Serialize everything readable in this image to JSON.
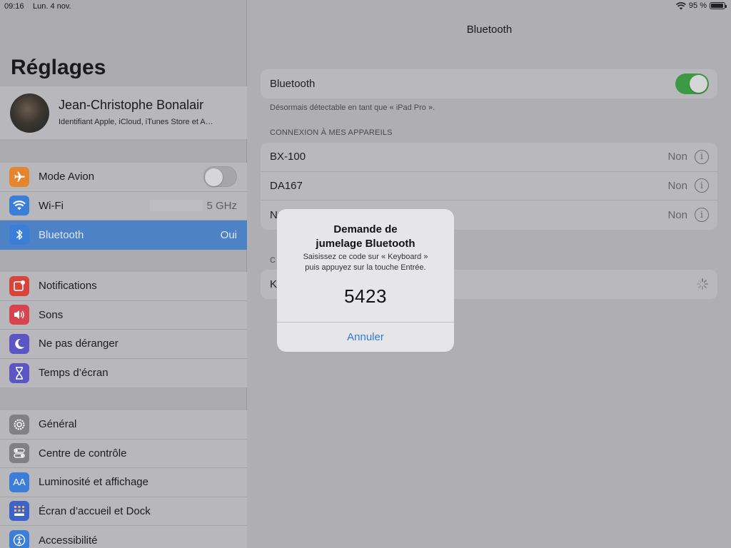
{
  "status_bar": {
    "time": "09:16",
    "date": "Lun. 4 nov.",
    "battery": "95 %",
    "battery_level": 0.95
  },
  "sidebar": {
    "title": "Réglages",
    "profile": {
      "name": "Jean-Christophe Bonalair",
      "subtitle": "Identifiant Apple, iCloud, iTunes Store et A…"
    },
    "group1": [
      {
        "label": "Mode Avion",
        "icon": "airplane-icon",
        "color": "#e5852f",
        "toggle": "off"
      },
      {
        "label": "Wi-Fi",
        "icon": "wifi-icon",
        "color": "#3a7ed8",
        "value": "5 GHz"
      },
      {
        "label": "Bluetooth",
        "icon": "bluetooth-icon",
        "color": "#3a7ed8",
        "value": "Oui",
        "selected": true
      }
    ],
    "group2": [
      {
        "label": "Notifications",
        "icon": "notifications-icon",
        "color": "#d8443a"
      },
      {
        "label": "Sons",
        "icon": "sound-icon",
        "color": "#d8434f"
      },
      {
        "label": "Ne pas déranger",
        "icon": "moon-icon",
        "color": "#5c55c4"
      },
      {
        "label": "Temps d’écran",
        "icon": "hourglass-icon",
        "color": "#5c55c4"
      }
    ],
    "group3": [
      {
        "label": "Général",
        "icon": "gear-icon",
        "color": "#808085"
      },
      {
        "label": "Centre de contrôle",
        "icon": "switches-icon",
        "color": "#808085"
      },
      {
        "label": "Luminosité et affichage",
        "icon": "text-size-icon",
        "color": "#3a7ed8",
        "glyph": "AA"
      },
      {
        "label": "Écran d’accueil et Dock",
        "icon": "home-grid-icon",
        "color": "#3b63c9"
      },
      {
        "label": "Accessibilité",
        "icon": "accessibility-icon",
        "color": "#3a7ed8"
      }
    ]
  },
  "main": {
    "nav_title": "Bluetooth",
    "bluetooth_row": {
      "label": "Bluetooth",
      "toggle": "on"
    },
    "discoverable_note": "Désormais détectable en tant que « iPad Pro ».",
    "my_devices_header": "CONNEXION À MES APPAREILS",
    "my_devices": [
      {
        "name": "BX-100",
        "status": "Non"
      },
      {
        "name": "DA167",
        "status": "Non"
      },
      {
        "name": "N",
        "status": "Non"
      }
    ],
    "other_devices_header": "C",
    "other_devices": [
      {
        "name": "K"
      }
    ]
  },
  "alert": {
    "title_line1": "Demande de",
    "title_line2": "jumelage Bluetooth",
    "message_line1": "Saisissez ce code sur « Keyboard »",
    "message_line2": "puis appuyez sur la touche Entrée.",
    "code": "5423",
    "cancel_label": "Annuler"
  },
  "colors": {
    "accent": "#3478d6",
    "selected_row": "#4d82c6",
    "toggle_on": "#3c9a44"
  }
}
